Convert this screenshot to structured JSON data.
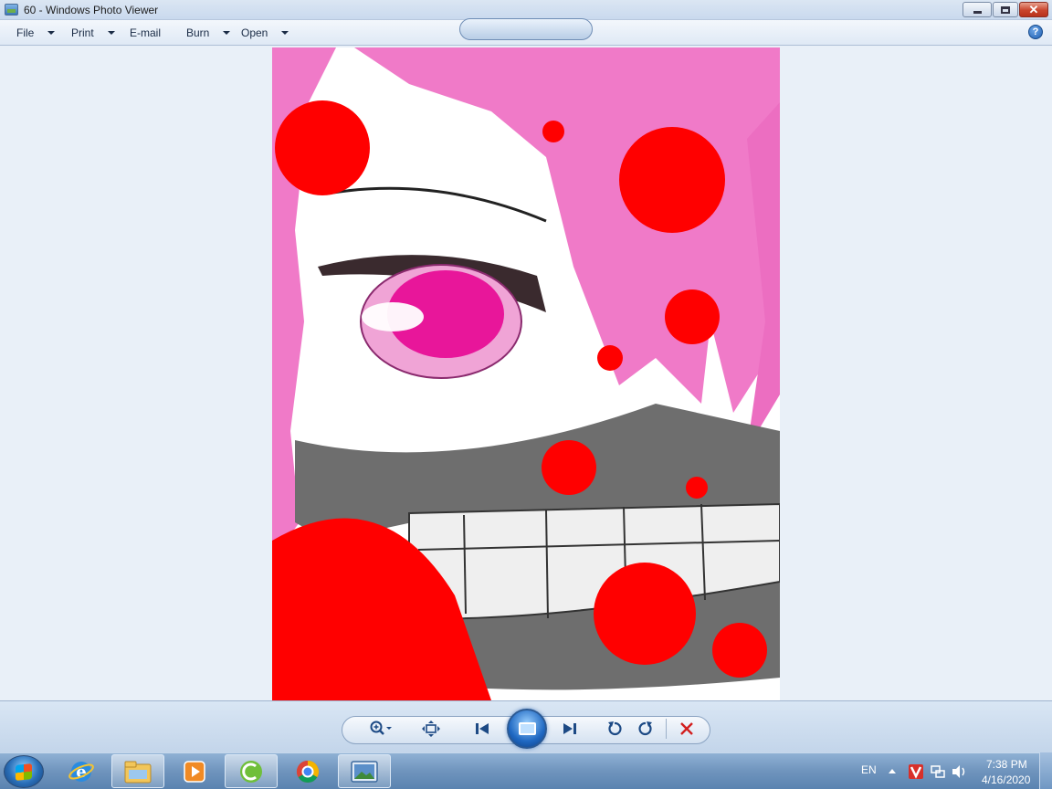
{
  "window": {
    "title": "60 - Windows Photo Viewer"
  },
  "menu": {
    "file": "File",
    "print": "Print",
    "email": "E-mail",
    "burn": "Burn",
    "open": "Open"
  },
  "help_icon": "help-icon",
  "controls": {
    "icons": [
      "zoom-icon",
      "actual-size-icon",
      "previous-icon",
      "play-slideshow-icon",
      "next-icon",
      "rotate-counterclockwise-icon",
      "rotate-clockwise-icon",
      "delete-icon"
    ]
  },
  "taskbar": {
    "apps": [
      "start-button",
      "internet-explorer-icon",
      "windows-explorer-icon",
      "media-player-icon",
      "cccleaner-icon",
      "chrome-icon",
      "photo-viewer-icon"
    ],
    "language": "EN",
    "time": "7:38 PM",
    "date": "4/16/2020"
  },
  "colors": {
    "blood_red": "#ff0000",
    "hair_pink": "#f07ac8",
    "eye_magenta": "#e8169a",
    "mask_gray": "#6e6e6e"
  }
}
